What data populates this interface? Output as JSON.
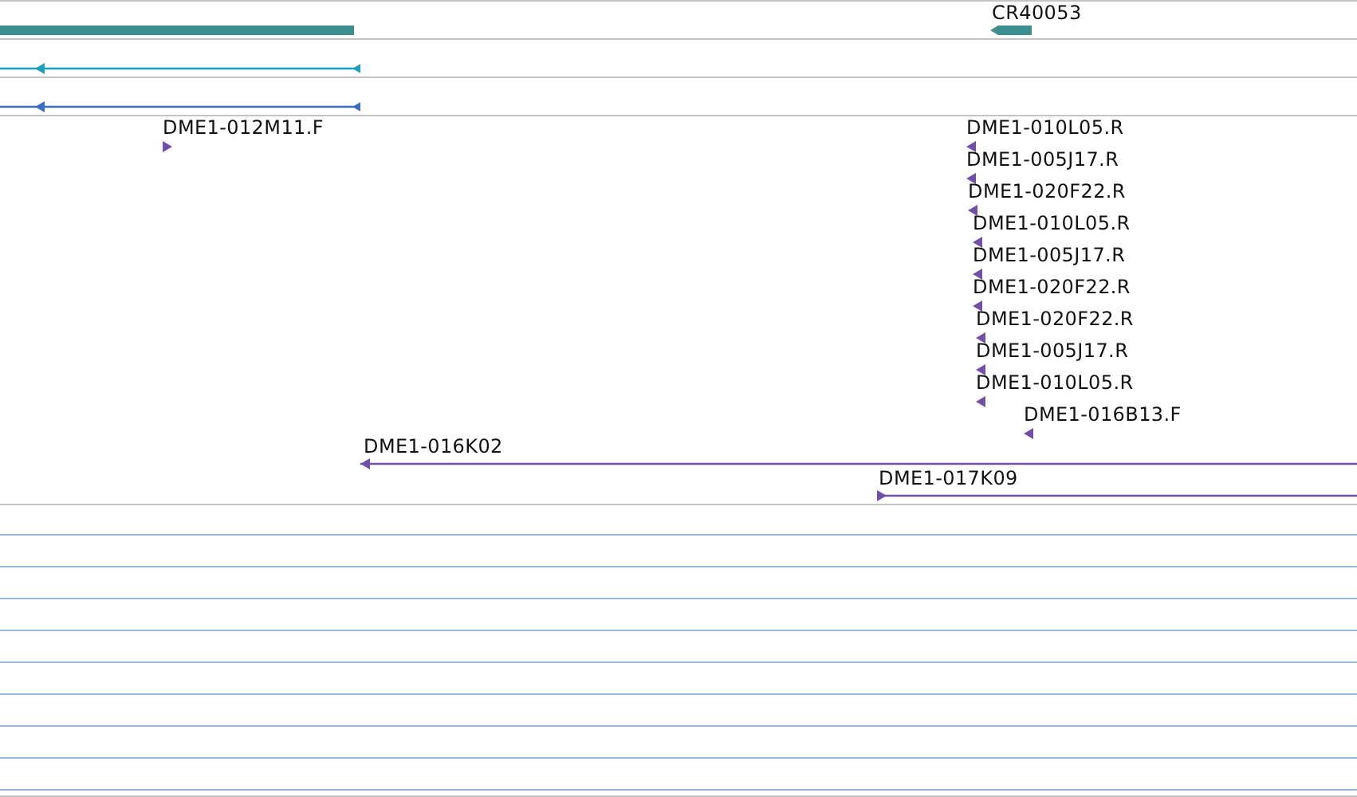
{
  "tracks": [
    {
      "color": "#3d8f8f",
      "features": [
        {
          "kind": "bar",
          "reverse": false
        },
        {
          "kind": "bar",
          "label": "CR40053",
          "reverse": true
        }
      ]
    },
    {
      "color": "#1aa0c0",
      "features": [
        {
          "kind": "line",
          "reverse": true
        }
      ]
    },
    {
      "color": "#3a6cc8",
      "features": [
        {
          "kind": "line",
          "reverse": true
        }
      ]
    },
    {
      "color": "#7050a8",
      "features": [
        {
          "kind": "tick",
          "label": "DME1-012M11.F",
          "reverse": false
        },
        {
          "kind": "tick",
          "label": "DME1-010L05.R",
          "reverse": true
        },
        {
          "kind": "tick",
          "label": "DME1-005J17.R",
          "reverse": true
        },
        {
          "kind": "tick",
          "label": "DME1-020F22.R",
          "reverse": true
        },
        {
          "kind": "tick",
          "label": "DME1-010L05.R",
          "reverse": true
        },
        {
          "kind": "tick",
          "label": "DME1-005J17.R",
          "reverse": true
        },
        {
          "kind": "tick",
          "label": "DME1-020F22.R",
          "reverse": true
        },
        {
          "kind": "tick",
          "label": "DME1-020F22.R",
          "reverse": true
        },
        {
          "kind": "tick",
          "label": "DME1-005J17.R",
          "reverse": true
        },
        {
          "kind": "tick",
          "label": "DME1-010L05.R",
          "reverse": true
        },
        {
          "kind": "tick",
          "label": "DME1-016B13.F",
          "reverse": true
        },
        {
          "kind": "span",
          "label": "DME1-016K02",
          "reverse": true
        },
        {
          "kind": "span",
          "label": "DME1-017K09",
          "reverse": false
        }
      ]
    }
  ]
}
